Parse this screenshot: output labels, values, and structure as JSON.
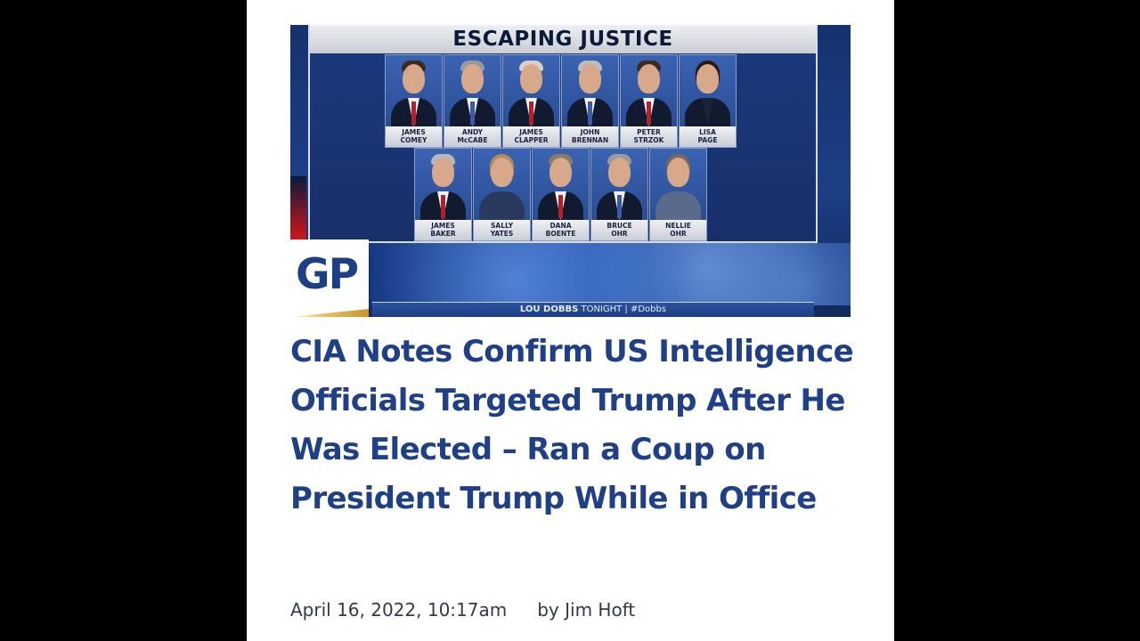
{
  "hero": {
    "board_title": "ESCAPING JUSTICE",
    "top_row": [
      {
        "name": "JAMES\nCOMEY"
      },
      {
        "name": "ANDY\nMcCABE"
      },
      {
        "name": "JAMES\nCLAPPER"
      },
      {
        "name": "JOHN\nBRENNAN"
      },
      {
        "name": "PETER\nSTRZOK"
      },
      {
        "name": "LISA\nPAGE"
      }
    ],
    "bottom_row": [
      {
        "name": "JAMES\nBAKER"
      },
      {
        "name": "SALLY\nYATES"
      },
      {
        "name": "DANA\nBOENTE"
      },
      {
        "name": "BRUCE\nOHR"
      },
      {
        "name": "NELLIE\nOHR"
      }
    ],
    "show_name": "LOU DOBBS",
    "show_suffix": " TONIGHT | #Dobbs",
    "logo_text": "GP"
  },
  "article": {
    "headline": "CIA Notes Confirm US Intelligence Officials Targeted Trump After He Was Elected – Ran a Coup on President Trump While in Office",
    "date": "April 16, 2022, 10:17am",
    "author": "by Jim Hoft"
  },
  "colors": {
    "headline": "#1f3f86",
    "background": "#000000",
    "page": "#ffffff"
  }
}
